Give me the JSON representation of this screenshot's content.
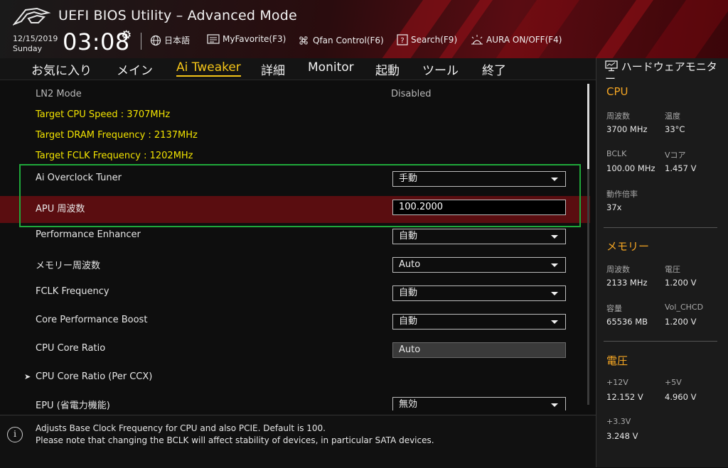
{
  "header": {
    "title": "UEFI BIOS Utility – Advanced Mode",
    "date": "12/15/2019",
    "day": "Sunday",
    "time": "03:08",
    "toolbar": [
      {
        "icon": "globe-icon",
        "label": "日本語"
      },
      {
        "icon": "favorite-icon",
        "label": "MyFavorite(F3)"
      },
      {
        "icon": "fan-icon",
        "label": "Qfan Control(F6)"
      },
      {
        "icon": "search-icon",
        "label": "Search(F9)"
      },
      {
        "icon": "aura-icon",
        "label": "AURA ON/OFF(F4)"
      }
    ]
  },
  "tabs": [
    {
      "label": "お気に入り"
    },
    {
      "label": "メイン"
    },
    {
      "label": "Ai Tweaker",
      "active": true
    },
    {
      "label": "詳細"
    },
    {
      "label": "Monitor"
    },
    {
      "label": "起動"
    },
    {
      "label": "ツール"
    },
    {
      "label": "終了"
    }
  ],
  "settings": {
    "ln2_mode": {
      "label": "LN2 Mode",
      "value": "Disabled"
    },
    "target_cpu": "Target CPU Speed : 3707MHz",
    "target_dram": "Target DRAM Frequency : 2137MHz",
    "target_fclk": "Target FCLK Frequency : 1202MHz",
    "ai_overclock": {
      "label": "Ai Overclock Tuner",
      "value": "手動"
    },
    "apu_freq": {
      "label": "APU 周波数",
      "value": "100.2000"
    },
    "perf_enhancer": {
      "label": "Performance Enhancer",
      "value": "自動"
    },
    "mem_freq": {
      "label": "メモリー周波数",
      "value": "Auto"
    },
    "fclk": {
      "label": "FCLK Frequency",
      "value": "自動"
    },
    "cpb": {
      "label": "Core Performance Boost",
      "value": "自動"
    },
    "core_ratio": {
      "label": "CPU Core Ratio",
      "value": "Auto"
    },
    "core_ratio_ccx": {
      "label": "CPU Core Ratio (Per CCX)"
    },
    "epu": {
      "label": "EPU (省電力機能)",
      "value": "無効"
    }
  },
  "help": {
    "line1": "Adjusts Base Clock Frequency for CPU and also PCIE. Default is 100.",
    "line2": "Please note that changing the BCLK will affect stability of devices, in particular SATA devices."
  },
  "hwmon": {
    "title": "ハードウェアモニター",
    "cpu": {
      "heading": "CPU",
      "freq_label": "周波数",
      "freq_value": "3700 MHz",
      "temp_label": "温度",
      "temp_value": "33°C",
      "bclk_label": "BCLK",
      "bclk_value": "100.00 MHz",
      "vcore_label": "Vコア",
      "vcore_value": "1.457 V",
      "ratio_label": "動作倍率",
      "ratio_value": "37x"
    },
    "memory": {
      "heading": "メモリー",
      "freq_label": "周波数",
      "freq_value": "2133 MHz",
      "volt_label": "電圧",
      "volt_value": "1.200 V",
      "cap_label": "容量",
      "cap_value": "65536 MB",
      "vol_chcd_label": "Vol_CHCD",
      "vol_chcd_value": "1.200 V"
    },
    "voltage": {
      "heading": "電圧",
      "v12_label": "+12V",
      "v12_value": "12.152 V",
      "v5_label": "+5V",
      "v5_value": "4.960 V",
      "v33_label": "+3.3V",
      "v33_value": "3.248 V"
    }
  },
  "colors": {
    "accent": "#f5c518",
    "info_text": "#f2e300",
    "highlight_row": "#5a0d10",
    "selection_box": "#1fa83a",
    "hw_heading": "#f5a623"
  }
}
